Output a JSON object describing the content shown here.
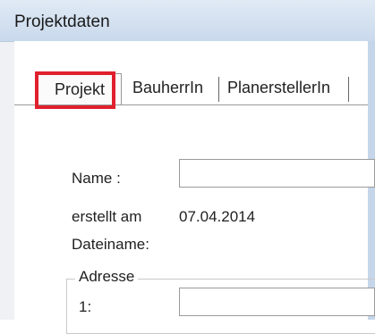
{
  "window": {
    "title": "Projektdaten"
  },
  "tabs": [
    {
      "label": "Projekt",
      "active": true
    },
    {
      "label": "BauherrIn"
    },
    {
      "label": "PlanerstellerIn"
    }
  ],
  "form": {
    "name_label": "Name :",
    "name_value": "",
    "created_label": "erstellt am",
    "created_value": "07.04.2014",
    "filename_label": "Dateiname:",
    "address_group": "Adresse",
    "address_line1_label": "1:"
  },
  "colors": {
    "highlight": "#e0202d"
  }
}
